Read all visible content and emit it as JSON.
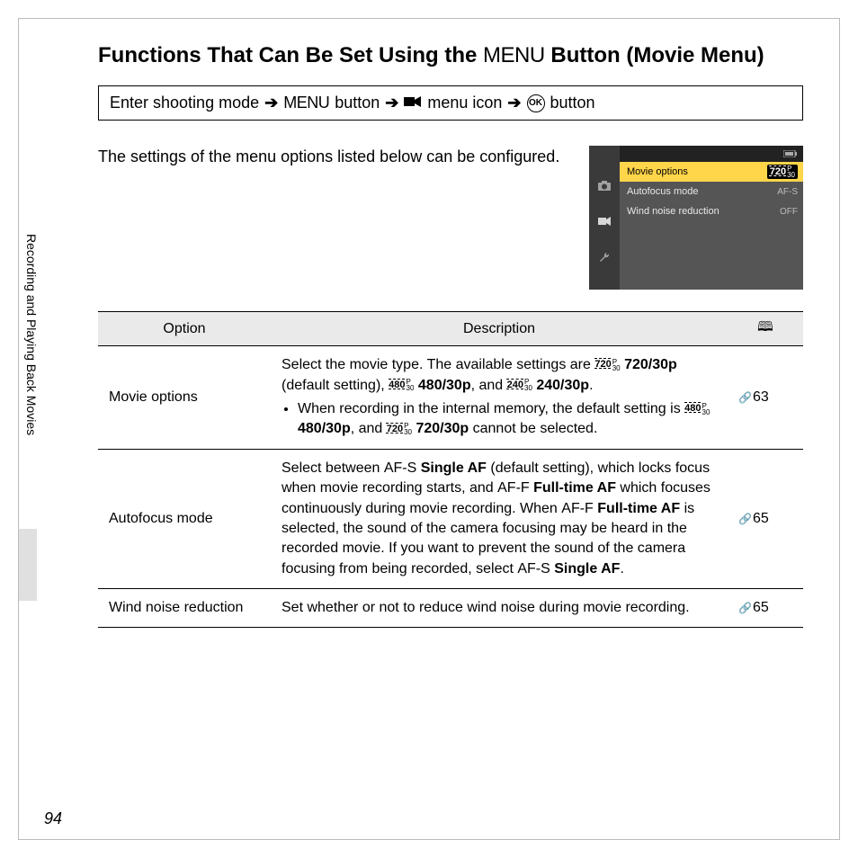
{
  "title_pre": "Functions That Can Be Set Using the ",
  "title_menu_glyph": "MENU",
  "title_post": " Button (Movie Menu)",
  "breadcrumb": {
    "step1": "Enter shooting mode",
    "step2_glyph": "MENU",
    "step2_post": " button",
    "step3_post": " menu icon",
    "step4_post": " button"
  },
  "intro": "The settings of the menu options listed below can be configured.",
  "cam_menu": {
    "rows": [
      {
        "label": "Movie options",
        "value": "720 30",
        "selected": true
      },
      {
        "label": "Autofocus mode",
        "value": "AF-S",
        "selected": false
      },
      {
        "label": "Wind noise reduction",
        "value": "OFF",
        "selected": false
      }
    ]
  },
  "side_label": "Recording and Playing Back Movies",
  "table": {
    "headers": {
      "option": "Option",
      "description": "Description"
    },
    "rows": [
      {
        "option": "Movie options",
        "desc_pre": "Select the movie type. The available settings are ",
        "opt1": "720/30p",
        "opt1_note": " (default setting), ",
        "opt2": "480/30p",
        "mid": ", and ",
        "opt3": "240/30p",
        "end": ".",
        "bullet_pre": "When recording in the internal memory, the default setting is ",
        "bullet_opt": "480/30p",
        "bullet_mid": ", and ",
        "bullet_opt2": "720/30p",
        "bullet_end": " cannot be selected.",
        "ref": "63"
      },
      {
        "option": "Autofocus mode",
        "p1": "Select between ",
        "af_s": "AF-S",
        "single": " Single AF",
        "p2": " (default setting), which locks focus when movie recording starts, and ",
        "af_f": "AF-F",
        "full": " Full-time AF",
        "p3": " which focuses continuously during movie recording. When ",
        "p4": " is selected, the sound of the camera focusing may be heard in the recorded movie. If you want to prevent the sound of the camera focusing from being recorded, select ",
        "p5": ".",
        "ref": "65"
      },
      {
        "option": "Wind noise reduction",
        "desc": "Set whether or not to reduce wind noise during movie recording.",
        "ref": "65"
      }
    ]
  },
  "page_number": "94"
}
